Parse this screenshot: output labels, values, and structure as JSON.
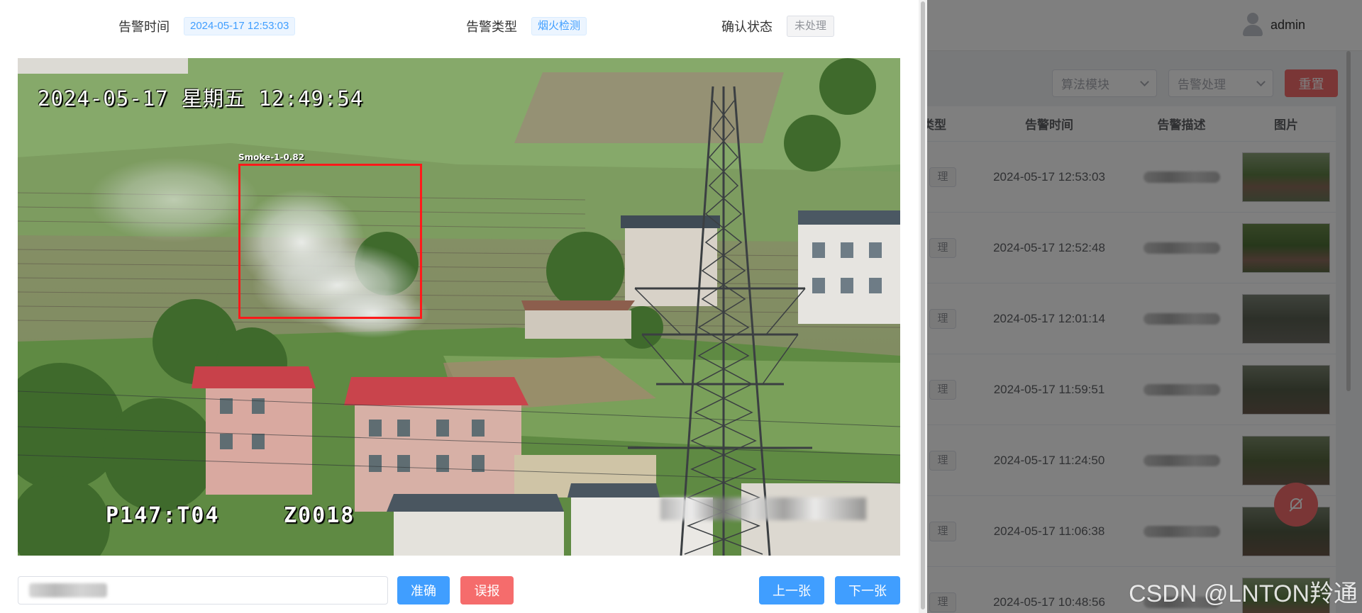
{
  "header": {
    "username": "admin"
  },
  "filters": {
    "algorithm_placeholder": "算法模块",
    "handling_placeholder": "告警处理",
    "reset_label": "重置"
  },
  "table": {
    "columns": {
      "type": "类型",
      "time": "告警时间",
      "desc": "告警描述",
      "image": "图片"
    },
    "rows": [
      {
        "status": "理",
        "time": "2024-05-17 12:53:03"
      },
      {
        "status": "理",
        "time": "2024-05-17 12:52:48"
      },
      {
        "status": "理",
        "time": "2024-05-17 12:01:14"
      },
      {
        "status": "理",
        "time": "2024-05-17 11:59:51"
      },
      {
        "status": "理",
        "time": "2024-05-17 11:24:50"
      },
      {
        "status": "理",
        "time": "2024-05-17 11:06:38"
      },
      {
        "status": "理",
        "time": "2024-05-17 10:48:56"
      }
    ]
  },
  "dialog": {
    "alarm_time_label": "告警时间",
    "alarm_time_value": "2024-05-17 12:53:03",
    "alarm_type_label": "告警类型",
    "alarm_type_value": "烟火检测",
    "confirm_status_label": "确认状态",
    "confirm_status_value": "未处理",
    "image": {
      "osd_datetime": "2024-05-17 星期五 12:49:54",
      "osd_camera": "P147:T04",
      "osd_code": "Z0018",
      "detection_label": "Smoke-1-0.82"
    },
    "buttons": {
      "accurate": "准确",
      "false_alarm": "误报",
      "prev": "上一张",
      "next": "下一张"
    }
  },
  "watermark": "CSDN @LNTON羚通",
  "colors": {
    "primary": "#409eff",
    "danger": "#f56c6c",
    "detection_box": "#ff1a1a"
  }
}
